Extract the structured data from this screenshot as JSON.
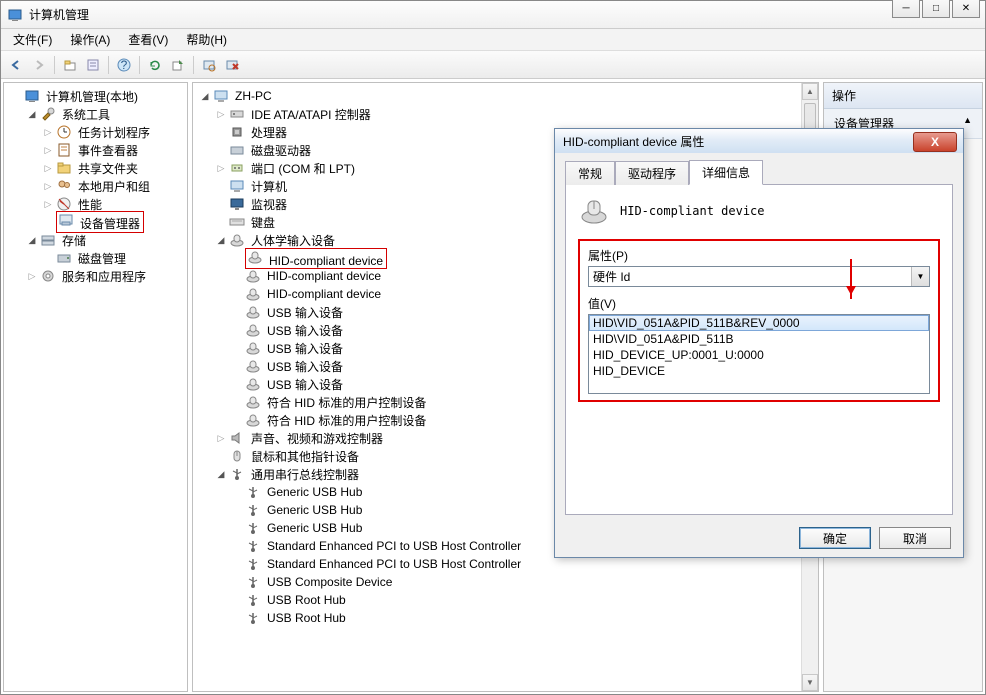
{
  "window": {
    "title": "计算机管理"
  },
  "menus": {
    "file": "文件(F)",
    "action": "操作(A)",
    "view": "查看(V)",
    "help": "帮助(H)"
  },
  "leftTree": [
    {
      "indent": 0,
      "toggle": "",
      "icon": "mgmt",
      "label": "计算机管理(本地)"
    },
    {
      "indent": 1,
      "toggle": "▾",
      "icon": "tools",
      "label": "系统工具"
    },
    {
      "indent": 2,
      "toggle": "▸",
      "icon": "sched",
      "label": "任务计划程序"
    },
    {
      "indent": 2,
      "toggle": "▸",
      "icon": "event",
      "label": "事件查看器"
    },
    {
      "indent": 2,
      "toggle": "▸",
      "icon": "share",
      "label": "共享文件夹"
    },
    {
      "indent": 2,
      "toggle": "▸",
      "icon": "users",
      "label": "本地用户和组"
    },
    {
      "indent": 2,
      "toggle": "▸",
      "icon": "perf",
      "label": "性能"
    },
    {
      "indent": 2,
      "toggle": "",
      "icon": "device",
      "label": "设备管理器",
      "boxed": true
    },
    {
      "indent": 1,
      "toggle": "▾",
      "icon": "storage",
      "label": "存储"
    },
    {
      "indent": 2,
      "toggle": "",
      "icon": "disk",
      "label": "磁盘管理"
    },
    {
      "indent": 1,
      "toggle": "▸",
      "icon": "service",
      "label": "服务和应用程序"
    }
  ],
  "centerTree": [
    {
      "indent": 0,
      "toggle": "▾",
      "icon": "pc",
      "label": "ZH-PC"
    },
    {
      "indent": 1,
      "toggle": "▸",
      "icon": "ide",
      "label": "IDE ATA/ATAPI 控制器"
    },
    {
      "indent": 1,
      "toggle": "",
      "icon": "cpu",
      "label": "处理器"
    },
    {
      "indent": 1,
      "toggle": "",
      "icon": "diskdrv",
      "label": "磁盘驱动器"
    },
    {
      "indent": 1,
      "toggle": "▸",
      "icon": "port",
      "label": "端口 (COM 和 LPT)"
    },
    {
      "indent": 1,
      "toggle": "",
      "icon": "pc",
      "label": "计算机"
    },
    {
      "indent": 1,
      "toggle": "",
      "icon": "monitor",
      "label": "监视器"
    },
    {
      "indent": 1,
      "toggle": "",
      "icon": "keyboard",
      "label": "键盘"
    },
    {
      "indent": 1,
      "toggle": "▾",
      "icon": "hid",
      "label": "人体学输入设备"
    },
    {
      "indent": 2,
      "toggle": "",
      "icon": "hid",
      "label": "HID-compliant device",
      "boxed": true
    },
    {
      "indent": 2,
      "toggle": "",
      "icon": "hid",
      "label": "HID-compliant device"
    },
    {
      "indent": 2,
      "toggle": "",
      "icon": "hid",
      "label": "HID-compliant device"
    },
    {
      "indent": 2,
      "toggle": "",
      "icon": "hid",
      "label": "USB 输入设备"
    },
    {
      "indent": 2,
      "toggle": "",
      "icon": "hid",
      "label": "USB 输入设备"
    },
    {
      "indent": 2,
      "toggle": "",
      "icon": "hid",
      "label": "USB 输入设备"
    },
    {
      "indent": 2,
      "toggle": "",
      "icon": "hid",
      "label": "USB 输入设备"
    },
    {
      "indent": 2,
      "toggle": "",
      "icon": "hid",
      "label": "USB 输入设备"
    },
    {
      "indent": 2,
      "toggle": "",
      "icon": "hid",
      "label": "符合 HID 标准的用户控制设备"
    },
    {
      "indent": 2,
      "toggle": "",
      "icon": "hid",
      "label": "符合 HID 标准的用户控制设备"
    },
    {
      "indent": 1,
      "toggle": "▸",
      "icon": "sound",
      "label": "声音、视频和游戏控制器"
    },
    {
      "indent": 1,
      "toggle": "",
      "icon": "mouse",
      "label": "鼠标和其他指针设备"
    },
    {
      "indent": 1,
      "toggle": "▾",
      "icon": "usb",
      "label": "通用串行总线控制器"
    },
    {
      "indent": 2,
      "toggle": "",
      "icon": "usb",
      "label": "Generic USB Hub"
    },
    {
      "indent": 2,
      "toggle": "",
      "icon": "usb",
      "label": "Generic USB Hub"
    },
    {
      "indent": 2,
      "toggle": "",
      "icon": "usb",
      "label": "Generic USB Hub"
    },
    {
      "indent": 2,
      "toggle": "",
      "icon": "usb",
      "label": "Standard Enhanced PCI to USB Host Controller"
    },
    {
      "indent": 2,
      "toggle": "",
      "icon": "usb",
      "label": "Standard Enhanced PCI to USB Host Controller"
    },
    {
      "indent": 2,
      "toggle": "",
      "icon": "usb",
      "label": "USB Composite Device"
    },
    {
      "indent": 2,
      "toggle": "",
      "icon": "usb",
      "label": "USB Root Hub"
    },
    {
      "indent": 2,
      "toggle": "",
      "icon": "usb",
      "label": "USB Root Hub"
    }
  ],
  "rightPane": {
    "header": "操作",
    "item": "设备管理器"
  },
  "dialog": {
    "title": "HID-compliant device 属性",
    "tabs": {
      "general": "常规",
      "driver": "驱动程序",
      "details": "详细信息"
    },
    "deviceName": "HID-compliant device",
    "propertyLabel": "属性(P)",
    "propertyValue": "硬件 Id",
    "valueLabel": "值(V)",
    "values": [
      "HID\\VID_051A&PID_511B&REV_0000",
      "HID\\VID_051A&PID_511B",
      "HID_DEVICE_UP:0001_U:0000",
      "HID_DEVICE"
    ],
    "ok": "确定",
    "cancel": "取消"
  }
}
